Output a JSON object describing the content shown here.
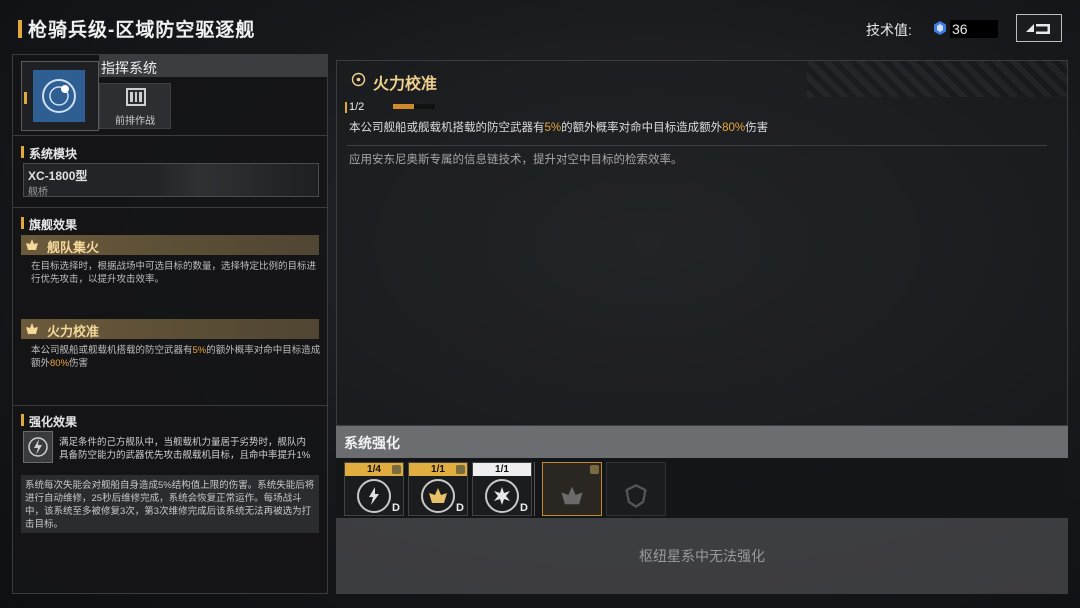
{
  "header": {
    "title": "枪骑兵级-区域防空驱逐舰",
    "tech_label": "技术值:",
    "tech_value": "36"
  },
  "command": {
    "title": "指挥系统",
    "sub_label": "前排作战"
  },
  "module": {
    "section_title": "系统模块",
    "name": "XC-1800型",
    "type": "舰桥"
  },
  "flagship": {
    "section_title": "旗舰效果",
    "effects": [
      {
        "name": "舰队集火",
        "desc": "在目标选择时，根据战场中可选目标的数量，选择特定比例的目标进行优先攻击，以提升攻击效率。"
      },
      {
        "name": "火力校准",
        "desc_a": "本公司舰船或舰载机搭载的防空武器有",
        "desc_hl1": "5%",
        "desc_b": "的额外概率对命中目标造成额外",
        "desc_hl2": "80%",
        "desc_c": "伤害"
      }
    ]
  },
  "enhance": {
    "section_title": "强化效果",
    "text": "满足条件的己方舰队中，当舰载机力量居于劣势时，舰队内具备防空能力的武器优先攻击舰载机目标，且命中率提升1%",
    "box_text": "系统每次失能会对舰船自身造成5%结构值上限的伤害。系统失能后将进行自动维修，25秒后维修完成，系统会恢复正常运作。每场战斗中，该系统至多被修复3次，第3次维修完成后该系统无法再被选为打击目标。"
  },
  "detail": {
    "title": "火力校准",
    "level": "1/2",
    "level_progress": 0.5,
    "desc_a": "本公司舰船或舰载机搭载的防空武器有",
    "desc_hl1": "5%",
    "desc_b": "的额外概率对命中目标造成额外",
    "desc_hl2": "80%",
    "desc_c": "伤害",
    "desc2": "应用安东尼奥斯专属的信息链技术，提升对空中目标的检索效率。"
  },
  "system_enhance": {
    "title": "系统强化",
    "slots": [
      {
        "count": "1/4",
        "grade": "D",
        "icon": "lightning-icon"
      },
      {
        "count": "1/1",
        "grade": "D",
        "icon": "crown-icon"
      },
      {
        "count": "1/1",
        "grade": "D",
        "icon": "burst-icon"
      }
    ],
    "unavailable": "枢纽星系中无法强化"
  },
  "colors": {
    "accent": "#e0a93a",
    "highlight": "#e9a43a"
  }
}
